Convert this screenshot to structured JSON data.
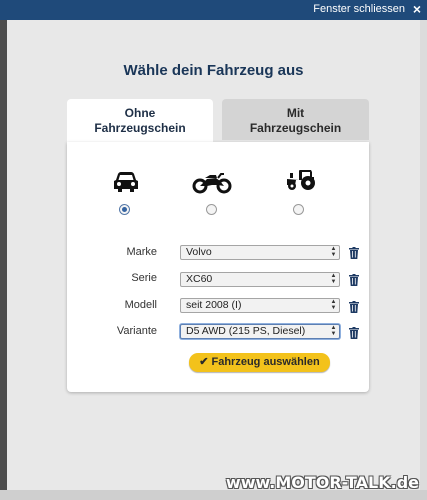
{
  "header": {
    "close_label": "Fenster schliessen",
    "close_icon": "×"
  },
  "dialog": {
    "title": "Wähle dein Fahrzeug aus",
    "tabs": [
      {
        "label_line1": "Ohne",
        "label_line2": "Fahrzeugschein",
        "active": true
      },
      {
        "label_line1": "Mit",
        "label_line2": "Fahrzeugschein",
        "active": false
      }
    ],
    "vehicle_types": [
      {
        "icon": "car-icon",
        "selected": true
      },
      {
        "icon": "motorcycle-icon",
        "selected": false
      },
      {
        "icon": "tractor-icon",
        "selected": false
      }
    ],
    "fields": [
      {
        "label": "Marke",
        "value": "Volvo"
      },
      {
        "label": "Serie",
        "value": "XC60"
      },
      {
        "label": "Modell",
        "value": "seit 2008 (I)"
      },
      {
        "label": "Variante",
        "value": "D5 AWD (215 PS, Diesel)"
      }
    ],
    "submit_label": "Fahrzeug auswählen",
    "submit_icon": "✔"
  },
  "watermark": "www.MOTOR-TALK.de",
  "colors": {
    "header_bg": "#1f4a7a",
    "title": "#1a3658",
    "button": "#f3c21b",
    "radio_selected": "#3463a1"
  }
}
